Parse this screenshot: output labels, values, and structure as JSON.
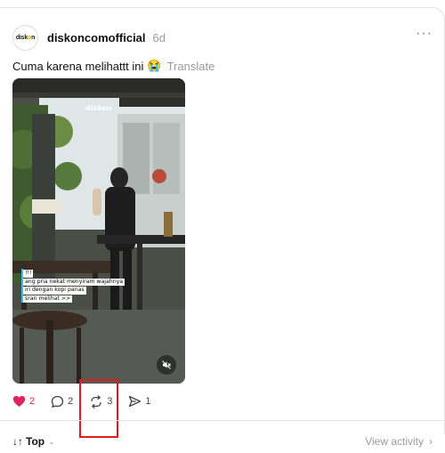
{
  "post": {
    "avatar_text_left": "disk",
    "avatar_text_o": "o",
    "avatar_text_right": "n",
    "username": "diskoncomofficial",
    "time": "6d",
    "more_label": "···",
    "caption": "Cuma karena melihattt ini",
    "caption_emoji": "😭",
    "translate_label": "Translate"
  },
  "media": {
    "watermark": "diskon",
    "overlay_lines": [
      "!!!",
      "ang pria nekat menyiram wajahnya",
      "iri dengan kopi panas",
      "sran melihat >>"
    ],
    "muted": true
  },
  "actions": {
    "likes": "2",
    "comments": "2",
    "reposts": "3",
    "shares": "1",
    "liked": true,
    "like_color": "#e0245e"
  },
  "footer": {
    "sort_arrows": "↓↑",
    "sort_label": "Top",
    "sort_chevron": "⌄",
    "view_activity": "View activity",
    "view_activity_chevron": "›"
  },
  "annotation": {
    "highlight_color": "#e11a1a"
  }
}
